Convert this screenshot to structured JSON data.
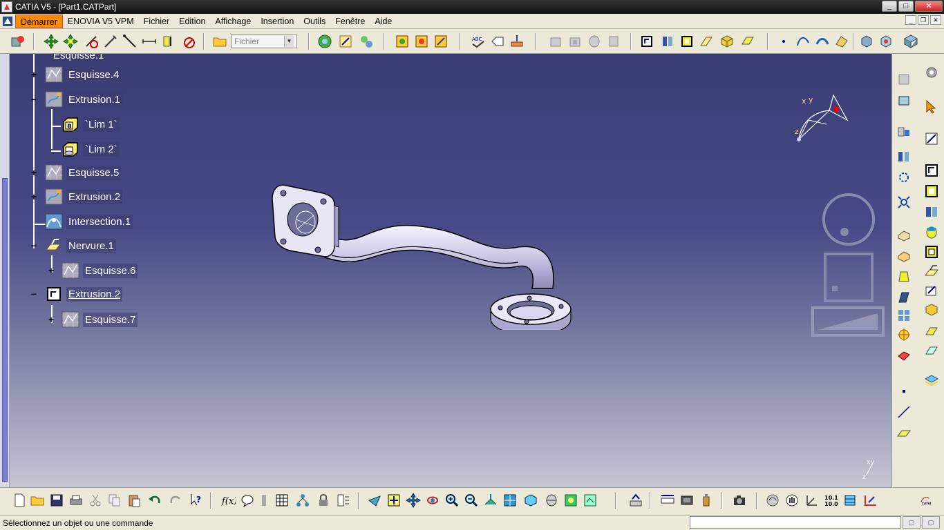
{
  "window": {
    "title": "CATIA V5 - [Part1.CATPart]",
    "controls": {
      "minimize": "_",
      "maximize": "□",
      "close": "✕"
    }
  },
  "menubar": {
    "items": [
      "Démarrer",
      "ENOVIA V5 VPM",
      "Fichier",
      "Edition",
      "Affichage",
      "Insertion",
      "Outils",
      "Fenêtre",
      "Aide"
    ],
    "active": "Démarrer"
  },
  "toolbar": {
    "workbench_combo": "Fichier"
  },
  "tree": {
    "partial_top": "Esquisse.1",
    "nodes": [
      {
        "label": "Esquisse.4",
        "expander": "+"
      },
      {
        "label": "Extrusion.1",
        "expander": "−"
      },
      {
        "label": "`Lim 1`",
        "expander": ""
      },
      {
        "label": "`Lim 2`",
        "expander": ""
      },
      {
        "label": "Esquisse.5",
        "expander": "+"
      },
      {
        "label": "Extrusion.2",
        "expander": "+"
      },
      {
        "label": "Intersection.1",
        "expander": ""
      },
      {
        "label": "Nervure.1",
        "expander": "−"
      },
      {
        "label": "Esquisse.6",
        "expander": "+"
      },
      {
        "label": "Extrusion.2",
        "expander": "−"
      },
      {
        "label": "Esquisse.7",
        "expander": "+"
      }
    ]
  },
  "compass": {
    "x": "x",
    "y": "y",
    "z": "z"
  },
  "axis_mini": {
    "x": "x",
    "y": "y",
    "z": "z"
  },
  "status": {
    "message": "Sélectionnez un objet ou une commande",
    "input_value": ""
  },
  "colors": {
    "background_top": "#3a3c75",
    "background_bottom": "#c5c6d4",
    "part_shade": "#d8d8ee",
    "menu_highlight": "#ff8a00"
  },
  "icons": {
    "top_toolbar": [
      "tools-palette-icon",
      "compass-manipulate-icon",
      "move-icon",
      "snap-icon",
      "pick-icon",
      "line-icon",
      "dimension-icon",
      "constraint-icon",
      "delete-icon",
      "open-folder-icon",
      "catalog-icon",
      "options-icon",
      "knowledge-icon",
      "publish-icon",
      "update-icon",
      "sketch-analysis-icon",
      "spell-check-icon",
      "annotation-icon",
      "datum-icon",
      "pad-icon",
      "pocket-icon",
      "shaft-icon",
      "groove-icon",
      "rib-icon",
      "slot-icon",
      "multi-pad-icon",
      "point-icon",
      "spline-icon",
      "surface-icon",
      "thickness-icon"
    ],
    "bottom_toolbar": [
      "new-icon",
      "open-icon",
      "save-icon",
      "print-icon",
      "cut-icon",
      "copy-icon",
      "paste-icon",
      "undo-icon",
      "redo-icon",
      "whats-this-icon",
      "formula-icon",
      "comment-icon",
      "ruler-icon",
      "table-icon",
      "tree-icon",
      "lock-icon",
      "parameters-icon",
      "fly-icon",
      "fit-all-icon",
      "pan-icon",
      "rotate-icon",
      "zoom-in-icon",
      "zoom-out-icon",
      "normal-view-icon",
      "isometric-icon",
      "front-view-icon",
      "shading-icon",
      "render-icon",
      "hide-show-icon",
      "swap-icon",
      "measure-icon",
      "material-icon",
      "apply-icon",
      "camera-icon",
      "analysis-icon",
      "hand-icon",
      "axis-icon",
      "scale-icon",
      "grid-icon",
      "constraint-color-icon",
      "catia-logo"
    ],
    "right_toolbar": [
      "settings-icon",
      "arrow-select-icon",
      "sketch-icon",
      "pad-icon",
      "pocket-icon",
      "shaft-icon",
      "hole-icon",
      "rib-icon",
      "fillet-icon",
      "chamfer-icon",
      "draft-icon",
      "shell-icon",
      "thread-icon",
      "pattern-icon",
      "mirror-icon",
      "boolean-icon",
      "split-icon",
      "thicken-icon",
      "close-surface-icon",
      "point-icon",
      "line-icon",
      "plane-icon"
    ]
  }
}
